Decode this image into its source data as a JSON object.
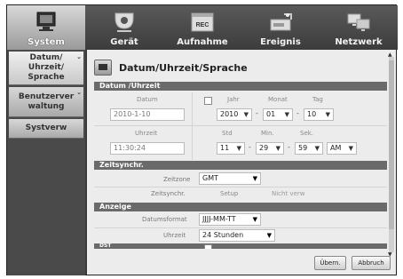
{
  "nav": {
    "tabs": [
      {
        "label": "System",
        "icon": "monitor-icon",
        "active": true
      },
      {
        "label": "Gerät",
        "icon": "camera-icon",
        "active": false
      },
      {
        "label": "Aufnahme",
        "icon": "rec-icon",
        "active": false
      },
      {
        "label": "Ereignis",
        "icon": "hdd-icon",
        "active": false
      },
      {
        "label": "Netzwerk",
        "icon": "network-icon",
        "active": false
      }
    ]
  },
  "sidebar": {
    "items": [
      {
        "label": "Datum/\nUhrzeit/\nSprache",
        "active": true
      },
      {
        "label": "Benutzerver\nwaltung",
        "active": false
      },
      {
        "label": "Systverw",
        "active": false
      }
    ]
  },
  "panel": {
    "title": "Datum/Uhrzeit/Sprache"
  },
  "datetime": {
    "section": "Datum /Uhrzeit",
    "datum_label": "Datum",
    "datum_value": "2010-1-10",
    "jahr_label": "Jahr",
    "monat_label": "Monat",
    "tag_label": "Tag",
    "jahr_value": "2010",
    "monat_value": "01",
    "tag_value": "10",
    "uhrzeit_label": "Uhrzeit",
    "uhrzeit_value": "11:30:24",
    "std_label": "Std",
    "min_label": "Min.",
    "sek_label": "Sek.",
    "std_value": "11",
    "min_value": "29",
    "sek_value": "59",
    "ampm_value": "AM",
    "dash": "-"
  },
  "sync": {
    "section": "Zeitsynchr.",
    "zeitzone_label": "Zeitzone",
    "zeitzone_value": "GMT",
    "zeitsynchr_label": "Zeitsynchr.",
    "setup_label": "Setup",
    "status_value": "Nicht verw"
  },
  "display": {
    "section": "Anzeige",
    "datumsformat_label": "Datumsformat",
    "datumsformat_value": "JJJJ-MM-TT",
    "uhrzeit_label": "Uhrzeit",
    "uhrzeit_value": "24 Stunden",
    "dst_label": "DST"
  },
  "buttons": {
    "apply": "Übern.",
    "cancel": "Abbruch"
  },
  "colors": {
    "frame_bg": "#3a3a3a",
    "section_bg": "#6a6a6a",
    "active_tab": "#cfcfcf"
  }
}
